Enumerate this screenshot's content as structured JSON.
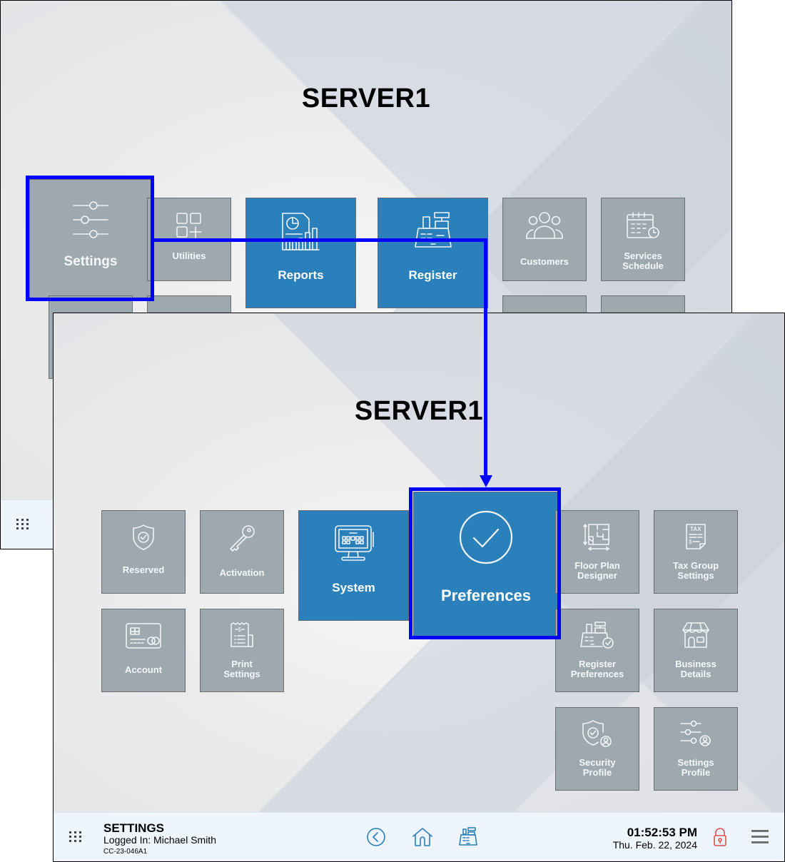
{
  "back_screen": {
    "title": "SERVER1",
    "tiles": [
      {
        "label": "Settings",
        "icon": "sliders-icon",
        "highlighted": true
      },
      {
        "label": "Utilities",
        "icon": "apps-add-icon"
      },
      {
        "label": "Reports",
        "icon": "report-chart-icon"
      },
      {
        "label": "Register",
        "icon": "cash-register-icon"
      },
      {
        "label": "Customers",
        "icon": "customers-group-icon"
      },
      {
        "label": "Services Schedule",
        "icon": "calendar-clock-icon"
      }
    ],
    "footer": {
      "menu_icon": "grid-dots-icon"
    }
  },
  "front_screen": {
    "title": "SERVER1",
    "tiles": [
      {
        "label": "Reserved",
        "icon": "shield-check-icon"
      },
      {
        "label": "Activation",
        "icon": "key-icon"
      },
      {
        "label": "System",
        "icon": "pos-monitor-icon"
      },
      {
        "label": "Preferences",
        "icon": "check-circle-icon",
        "highlighted": true
      },
      {
        "label": "Floor Plan Designer",
        "icon": "floor-plan-icon"
      },
      {
        "label": "Tax Group Settings",
        "icon": "tax-document-icon"
      },
      {
        "label": "Account",
        "icon": "credit-card-icon"
      },
      {
        "label": "Print Settings",
        "icon": "receipt-icon"
      },
      {
        "label": "Register Preferences",
        "icon": "register-check-icon"
      },
      {
        "label": "Business Details",
        "icon": "storefront-icon"
      },
      {
        "label": "Security Profile",
        "icon": "shield-user-icon"
      },
      {
        "label": "Settings Profile",
        "icon": "sliders-user-icon"
      }
    ],
    "footer": {
      "section": "SETTINGS",
      "logged_in": "Logged In:  Michael Smith",
      "device_id": "CC-23-046A1",
      "time": "01:52:53 PM",
      "date": "Thu. Feb. 22, 2024",
      "nav": [
        {
          "name": "back",
          "icon": "back-circle-icon"
        },
        {
          "name": "home",
          "icon": "home-icon"
        },
        {
          "name": "register",
          "icon": "cash-register-icon"
        }
      ],
      "lock_icon": "lock-icon",
      "menu_icon": "hamburger-menu-icon"
    }
  },
  "colors": {
    "tile_gray": "#9da8af",
    "tile_blue": "#2980ba",
    "highlight": "#0000ff",
    "footer_bg": "#eef5fc",
    "nav_icon": "#2a7fba",
    "lock": "#d9534f"
  }
}
